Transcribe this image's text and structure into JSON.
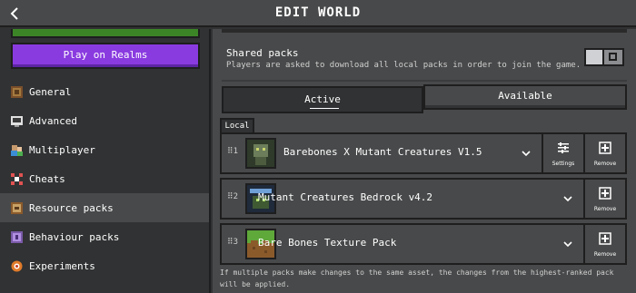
{
  "header": {
    "title": "EDIT WORLD",
    "back_icon": "chevron-left-icon"
  },
  "sidebar": {
    "realms_button": "Play on Realms",
    "items": [
      {
        "label": "General",
        "icon": "globe-icon",
        "active": false
      },
      {
        "label": "Advanced",
        "icon": "monitor-icon",
        "active": false
      },
      {
        "label": "Multiplayer",
        "icon": "players-icon",
        "active": false
      },
      {
        "label": "Cheats",
        "icon": "cheats-icon",
        "active": false
      },
      {
        "label": "Resource packs",
        "icon": "resource-pack-icon",
        "active": true
      },
      {
        "label": "Behaviour packs",
        "icon": "behaviour-pack-icon",
        "active": false
      },
      {
        "label": "Experiments",
        "icon": "experiments-icon",
        "active": false
      }
    ]
  },
  "shared": {
    "title": "Shared packs",
    "description": "Players are asked to download all local packs in order to join the game.",
    "toggle_on": false
  },
  "tabs": {
    "active": "Active",
    "available": "Available"
  },
  "local_label": "Local",
  "packs": [
    {
      "index": "1",
      "name": "Barebones X Mutant Creatures V1.5",
      "settings_label": "Settings",
      "remove_label": "Remove"
    },
    {
      "index": "2",
      "name": "Mutant Creatures Bedrock v4.2",
      "remove_label": "Remove"
    },
    {
      "index": "3",
      "name": "Bare Bones Texture Pack",
      "remove_label": "Remove"
    }
  ],
  "footnote": "If multiple packs make changes to the same asset, the changes from the highest-ranked pack will be applied.",
  "colors": {
    "realms": "#8a3be0",
    "background": "#313233",
    "panel": "#48494a",
    "border": "#1e1e1f"
  }
}
